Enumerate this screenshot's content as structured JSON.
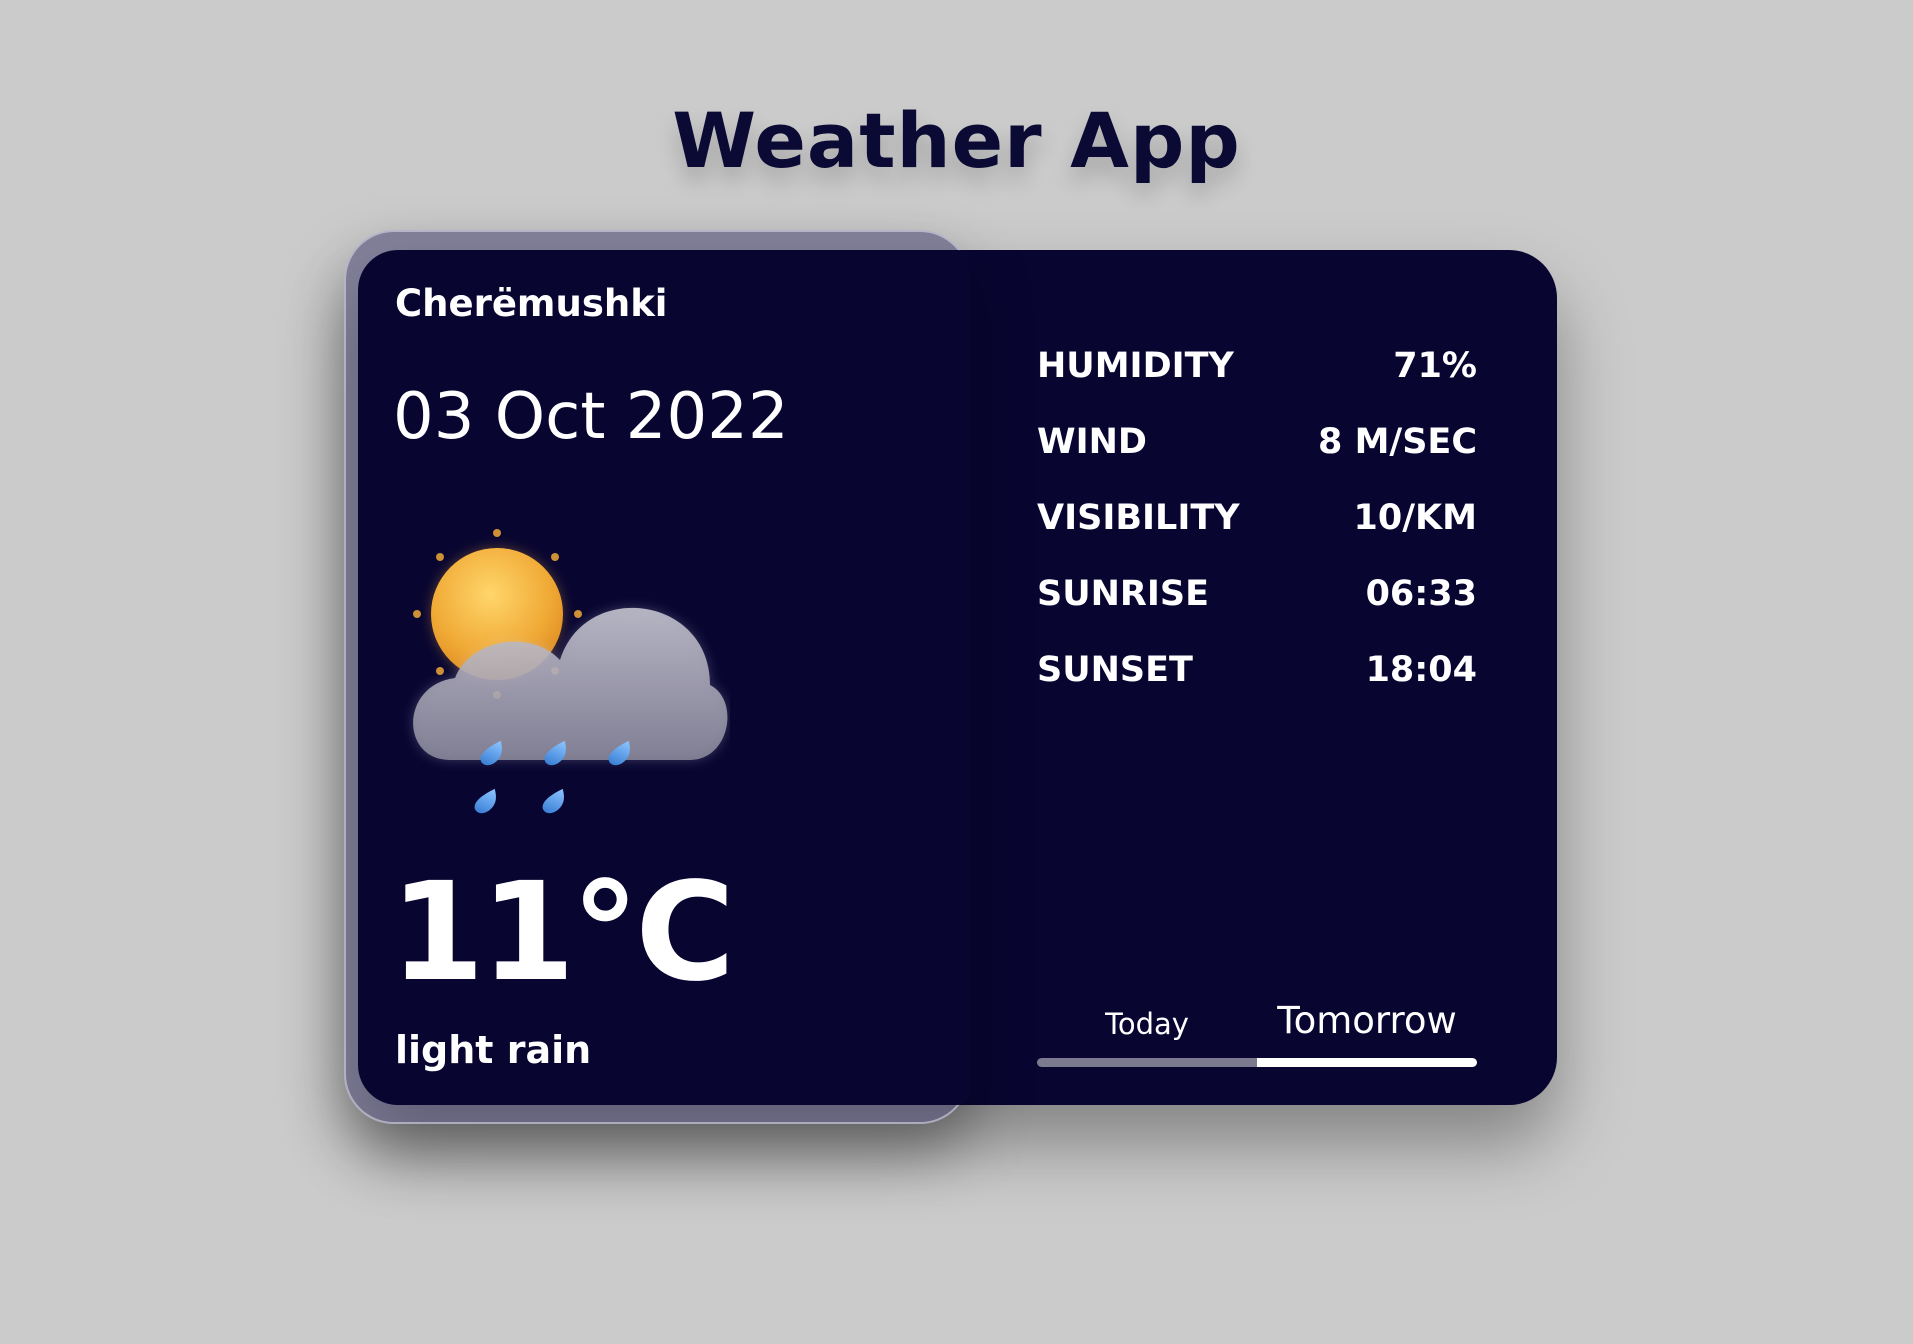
{
  "app": {
    "title": "Weather App"
  },
  "current": {
    "location": "Cherëmushki",
    "date": "03 Oct 2022",
    "temperature": "11°C",
    "description": "light rain",
    "icon": "sun-cloud-rain-icon"
  },
  "details": [
    {
      "label": "HUMIDITY",
      "value": "71%"
    },
    {
      "label": "WIND",
      "value": "8 M/SEC"
    },
    {
      "label": "VISIBILITY",
      "value": "10/KM"
    },
    {
      "label": "SUNRISE",
      "value": "06:33"
    },
    {
      "label": "SUNSET",
      "value": "18:04"
    }
  ],
  "tabs": [
    {
      "label": "Today",
      "active": false
    },
    {
      "label": "Tomorrow",
      "active": true
    }
  ],
  "colors": {
    "background": "#cbcbcb",
    "card": "#080531",
    "title": "#0b0a35",
    "text": "#ffffff",
    "tab_inactive": "#7b7a8e",
    "tab_active": "#ffffff",
    "sun": "#f5b43a",
    "rain": "#4a8fe0"
  }
}
